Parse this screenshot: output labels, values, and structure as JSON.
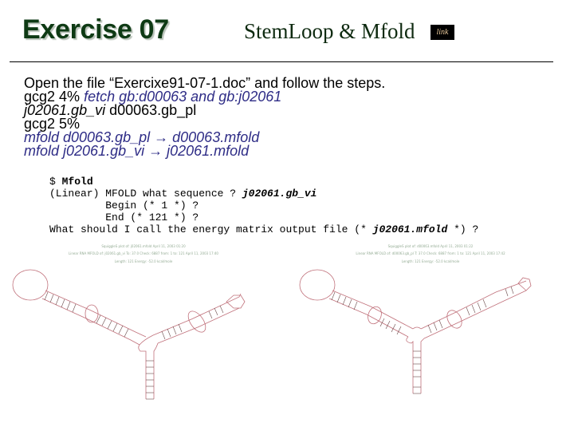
{
  "header": {
    "title": "Exercise 07",
    "subtitle": "StemLoop & Mfold",
    "link_label": "link"
  },
  "instructions": {
    "line1": "Open the file “Exercixe91-07-1.doc” and follow the steps.",
    "line2_prefix": "gcg2 4% ",
    "line2_cmd": "fetch gb:d00063 and gb:j02061",
    "line3_italic": "j02061.gb_vi",
    "line3_rest": "  d00063.gb_pl",
    "line4": "gcg2 5%",
    "line5_cmd": "mfold d00063.gb_pl",
    "line5_arrow": " → ",
    "line5_out": "d00063.mfold",
    "line6_cmd": "mfold j02061.gb_vi",
    "line6_arrow": " → ",
    "line6_out": "j02061.mfold"
  },
  "terminal": {
    "l1_prompt": "$ ",
    "l1_cmd": "Mfold",
    "l2_text": "(Linear) MFOLD what sequence ? ",
    "l2_input": "j02061.gb_vi",
    "l3_text": "         Begin (* 1 *) ?",
    "l4_text": "         End (* 121 *) ?",
    "l5_text": "What should I call the energy matrix output file (* ",
    "l5_input": "j02061.mfold",
    "l5_tail": " *) ?"
  },
  "diagrams": [
    {
      "name": "j02061-structure",
      "caption_lines": [
        "SquiggleS plot of: j02061.mfold  April 11, 2003 01:20",
        "Linear RNA MFOLD of: j02061.gb_vi  To: 37.0  Check: 6887  from: 1 to: 121  April 11, 2003 17:40",
        "Length: 121   Energy: -52.0 kcal/mole"
      ]
    },
    {
      "name": "d00063-structure",
      "caption_lines": [
        "SquiggleS plot of: d00063.mfold  April 11, 2003 01:22",
        "Linear RNA MFOLD of: d00063.gb_pl  T: 37.0  Check: 6887  from: 1 to: 121  April 11, 2003 17:42",
        "Length: 121   Energy: -52.0 kcal/mole"
      ]
    }
  ],
  "colors": {
    "title": "#0e3a14",
    "command_blue": "#2e2c86",
    "diagram_backbone": "#c0707a",
    "diagram_pairs": "#6a4a4a"
  }
}
